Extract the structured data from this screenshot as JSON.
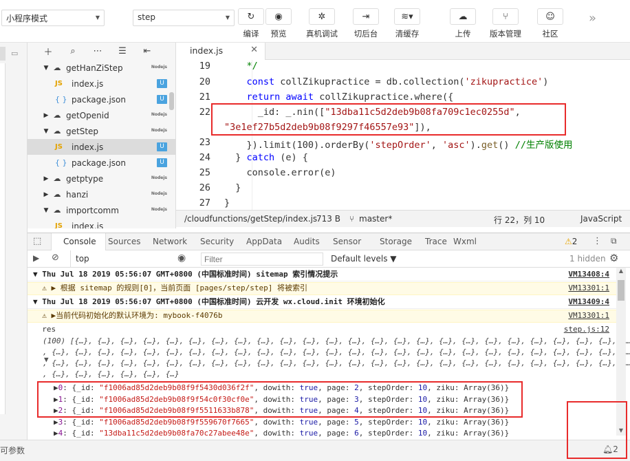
{
  "toolbar": {
    "mode_select": "小程序模式",
    "compile_select": "step",
    "buttons": [
      {
        "label": "编译",
        "icon": "↻"
      },
      {
        "label": "预览",
        "icon": "◉"
      },
      {
        "label": "真机调试",
        "icon": "✲"
      },
      {
        "label": "切后台",
        "icon": "⇥"
      },
      {
        "label": "清缓存",
        "icon": "≋▾"
      },
      {
        "label": "上传",
        "icon": "☁"
      },
      {
        "label": "版本管理",
        "icon": "⑂"
      },
      {
        "label": "社区",
        "icon": "☺"
      }
    ],
    "more": "»"
  },
  "tree": {
    "items": [
      {
        "label": "getHanZiStep",
        "kind": "folder-open",
        "tag": "Nodejs"
      },
      {
        "label": "index.js",
        "kind": "js",
        "tag": "U"
      },
      {
        "label": "package.json",
        "kind": "json",
        "tag": "U"
      },
      {
        "label": "getOpenid",
        "kind": "folder",
        "tag": "Nodejs"
      },
      {
        "label": "getStep",
        "kind": "folder-open",
        "tag": "Nodejs"
      },
      {
        "label": "index.js",
        "kind": "js",
        "tag": "U",
        "selected": true
      },
      {
        "label": "package.json",
        "kind": "json",
        "tag": "U"
      },
      {
        "label": "getptype",
        "kind": "folder",
        "tag": "Nodejs"
      },
      {
        "label": "hanzi",
        "kind": "folder",
        "tag": "Nodejs"
      },
      {
        "label": "importcomm",
        "kind": "folder-open",
        "tag": "Nodejs"
      },
      {
        "label": "index.js",
        "kind": "js",
        "tag": ""
      }
    ]
  },
  "editor": {
    "tab": "index.js",
    "line_numbers": [
      "19",
      "20",
      "21",
      "22",
      "",
      "23",
      "24",
      "25",
      "26",
      "27"
    ],
    "status": {
      "path": "/cloudfunctions/getStep/index.js",
      "size": "713 B",
      "branch": "master*",
      "position": "行 22，列 10",
      "lang": "JavaScript"
    }
  },
  "devtools": {
    "tabs": [
      "Console",
      "Sources",
      "Network",
      "Security",
      "AppData",
      "Audits",
      "Sensor",
      "Storage",
      "Trace",
      "Wxml"
    ],
    "warn_count": "2",
    "context": "top",
    "filter_placeholder": "Filter",
    "levels": "Default levels ▼",
    "hidden": "1 hidden"
  },
  "console": {
    "lines": [
      {
        "text": "▼ Thu Jul 18 2019 05:56:07 GMT+0800 (中国标准时间) sitemap 索引情况提示",
        "src": "VM13408:4"
      },
      {
        "text": "  ⚠ ▶ 根据 sitemap 的规则[0]，当前页面 [pages/step/step] 将被索引",
        "src": "VM13301:1"
      },
      {
        "text": "▼ Thu Jul 18 2019 05:56:07 GMT+0800 (中国标准时间) 云开发 wx.cloud.init 环境初始化",
        "src": "VM13409:4"
      },
      {
        "text": "  ⚠ ▶当前代码初始化的默认环境为: mybook-f4076b",
        "src": "VM13301:1"
      },
      {
        "text": "  res",
        "src": "step.js:12"
      }
    ],
    "array_preview": "(100) [{…}, {…}, {…}, {…}, {…}, {…}, {…}, {…}, {…}, {…}, {…}, {…}, {…}, {…}, {…}, {…}, {…}, {…}, {…}, {…}, {…}, {…}, {…}, {…}, {…}",
    "array_cont": ", {…}, {…}, {…}, {…}, {…}, {…}, {…}, {…}, {…}, {…}, {…}, {…}, {…}, {…}, {…}, {…}, {…}, {…}, {…}, {…}, {…}, {…}, {…}, {…}, {…}, {…}",
    "array_end": ", {…}, {…}, {…}, {…}, {…}, {…}",
    "items": [
      {
        "idx": "0",
        "id": "\"f1006ad85d2deb9b08f9f5430d036f2f\"",
        "page": "2",
        "order": "10"
      },
      {
        "idx": "1",
        "id": "\"f1006ad85d2deb9b08f9f54c0f30cf0e\"",
        "page": "3",
        "order": "10"
      },
      {
        "idx": "2",
        "id": "\"f1006ad85d2deb9b08f9f5511633b878\"",
        "page": "4",
        "order": "10"
      },
      {
        "idx": "3",
        "id": "\"f1006ad85d2deb9b08f9f559670f7665\"",
        "page": "5",
        "order": "10"
      },
      {
        "idx": "4",
        "id": "\"13dba11c5d2deb9b08fa70c27abee48e\"",
        "page": "6",
        "order": "10"
      }
    ]
  },
  "bottom": {
    "left": "可参数",
    "bell": "2"
  }
}
